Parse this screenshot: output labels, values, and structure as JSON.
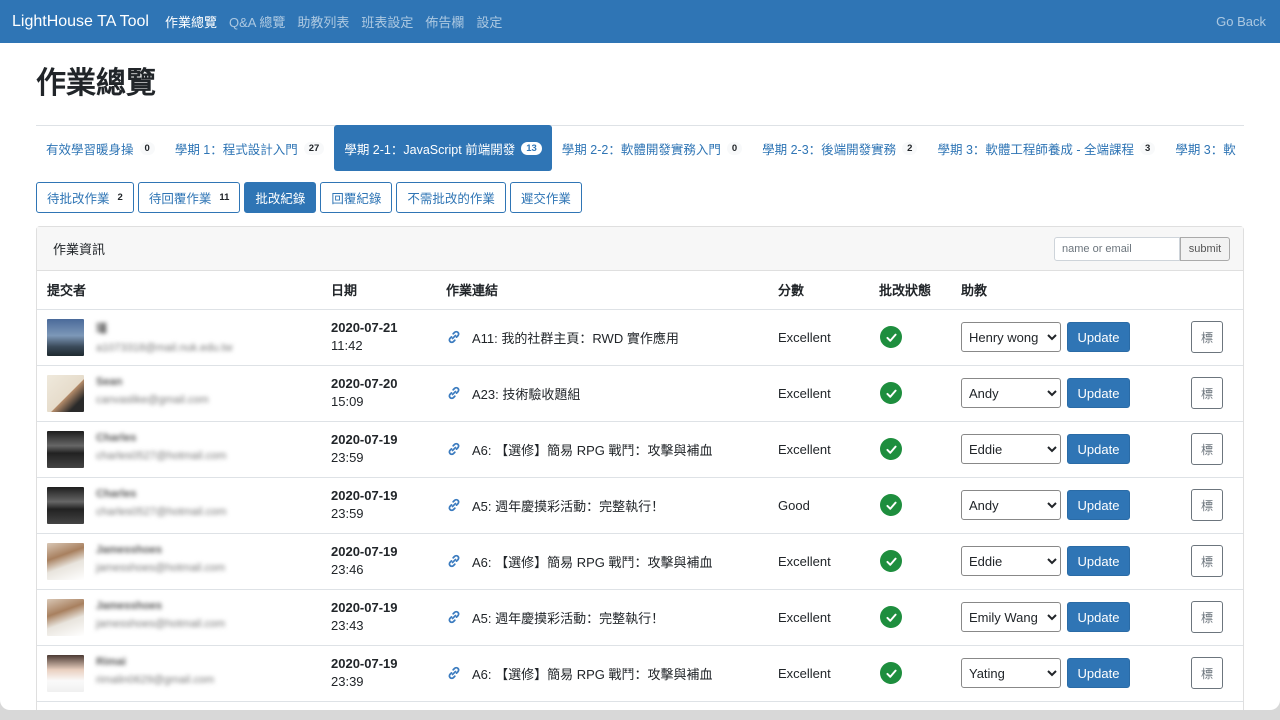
{
  "navbar": {
    "brand": "LightHouse TA Tool",
    "items": [
      "作業總覽",
      "Q&A 總覽",
      "助教列表",
      "班表設定",
      "佈告欄",
      "設定"
    ],
    "go_back": "Go Back"
  },
  "page_title": "作業總覽",
  "course_tabs": [
    {
      "label": "有效學習暖身操",
      "count": "0"
    },
    {
      "label": "學期 1：程式設計入門",
      "count": "27"
    },
    {
      "label": "學期 2-1：JavaScript 前端開發",
      "count": "13"
    },
    {
      "label": "學期 2-2：軟體開發實務入門",
      "count": "0"
    },
    {
      "label": "學期 2-3：後端開發實務",
      "count": "2"
    },
    {
      "label": "學期 3：軟體工程師養成 - 全端課程",
      "count": "3"
    },
    {
      "label": "學期 3：軟",
      "count": ""
    }
  ],
  "sub_tabs": [
    {
      "label": "待批改作業",
      "count": "2"
    },
    {
      "label": "待回覆作業",
      "count": "11"
    },
    {
      "label": "批改紀錄",
      "count": ""
    },
    {
      "label": "回覆紀錄",
      "count": ""
    },
    {
      "label": "不需批改的作業",
      "count": ""
    },
    {
      "label": "遲交作業",
      "count": ""
    }
  ],
  "card": {
    "title": "作業資訊",
    "search_placeholder": "name or email",
    "submit_label": "submit"
  },
  "table": {
    "headers": [
      "提交者",
      "日期",
      "作業連結",
      "分數",
      "批改狀態",
      "助教"
    ],
    "rows": [
      {
        "name": "瑾",
        "email": "a1073318@mail.nuk.edu.tw",
        "date": "2020-07-21",
        "time": "11:42",
        "assignment": "A11: 我的社群主頁：RWD 實作應用",
        "score": "Excellent",
        "ta": "Henry wong",
        "update": "Update",
        "mark": "標"
      },
      {
        "name": "Sean",
        "email": "canvaslike@gmail.com",
        "date": "2020-07-20",
        "time": "15:09",
        "assignment": "A23: 技術驗收題組",
        "score": "Excellent",
        "ta": "Andy",
        "update": "Update",
        "mark": "標"
      },
      {
        "name": "Charles",
        "email": "charles0527@hotmail.com",
        "date": "2020-07-19",
        "time": "23:59",
        "assignment": "A6: 【選修】簡易 RPG 戰鬥：攻擊與補血",
        "score": "Excellent",
        "ta": "Eddie",
        "update": "Update",
        "mark": "標"
      },
      {
        "name": "Charles",
        "email": "charles0527@hotmail.com",
        "date": "2020-07-19",
        "time": "23:59",
        "assignment": "A5: 週年慶摸彩活動：完整執行！",
        "score": "Good",
        "ta": "Andy",
        "update": "Update",
        "mark": "標"
      },
      {
        "name": "Jamesshoes",
        "email": "jamesshoes@hotmail.com",
        "date": "2020-07-19",
        "time": "23:46",
        "assignment": "A6: 【選修】簡易 RPG 戰鬥：攻擊與補血",
        "score": "Excellent",
        "ta": "Eddie",
        "update": "Update",
        "mark": "標"
      },
      {
        "name": "Jamesshoes",
        "email": "jamesshoes@hotmail.com",
        "date": "2020-07-19",
        "time": "23:43",
        "assignment": "A5: 週年慶摸彩活動：完整執行！",
        "score": "Excellent",
        "ta": "Emily Wang",
        "update": "Update",
        "mark": "標"
      },
      {
        "name": "Rimai",
        "email": "rimalin0629@gmail.com",
        "date": "2020-07-19",
        "time": "23:39",
        "assignment": "A6: 【選修】簡易 RPG 戰鬥：攻擊與補血",
        "score": "Excellent",
        "ta": "Yating",
        "update": "Update",
        "mark": "標"
      }
    ]
  },
  "icons": {
    "link": "link-icon",
    "status": "check-circle-icon"
  },
  "colors": {
    "primary": "#2f75b5",
    "success": "#1e8e3e"
  }
}
